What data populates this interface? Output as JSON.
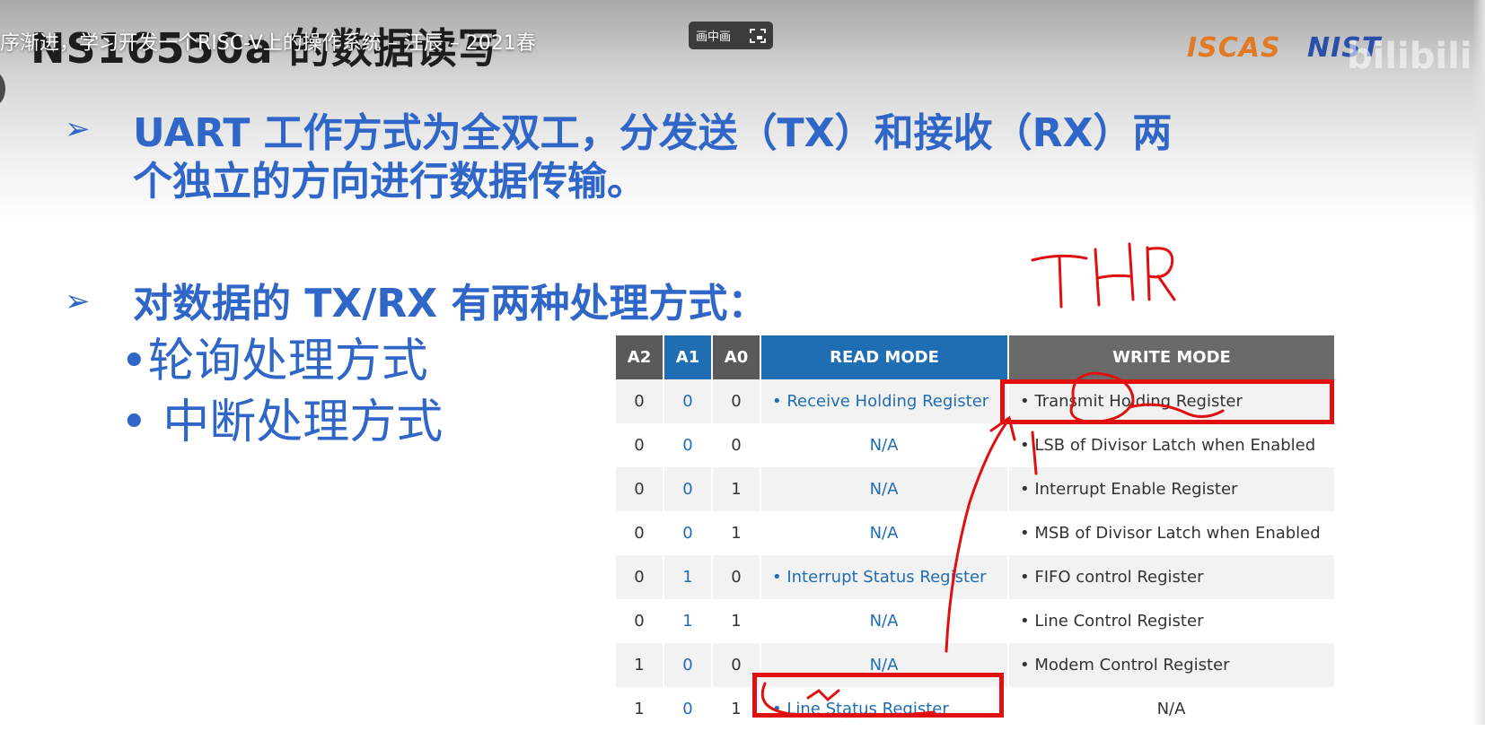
{
  "video": {
    "overlay_title": "序渐进，学习开发一个RISC-V上的操作系统 – 汪辰 – 2021春",
    "pip_label": "画中画"
  },
  "slide": {
    "title_behind": "NS16550a 的数据读写",
    "logos": {
      "iscas": "ISCAS",
      "nist": "NIST",
      "bilibili": "bilibili"
    },
    "bullet1_line1": "UART 工作方式为全双工，分发送（TX）和接收（RX）两",
    "bullet1_line2": "个独立的方向进行数据传输。",
    "bullet2": "对数据的 TX/RX 有两种处理方式：",
    "sub_bullets": [
      "•轮询处理方式",
      "• 中断处理方式"
    ],
    "handwritten_note": "THR"
  },
  "table": {
    "headers": [
      "A2",
      "A1",
      "A0",
      "READ MODE",
      "WRITE MODE"
    ],
    "rows": [
      {
        "a2": "0",
        "a1": "0",
        "a0": "0",
        "read": "• Receive Holding Register",
        "write": "• Transmit Holding Register"
      },
      {
        "a2": "0",
        "a1": "0",
        "a0": "0",
        "read": "N/A",
        "write": "• LSB of Divisor Latch when Enabled"
      },
      {
        "a2": "0",
        "a1": "0",
        "a0": "1",
        "read": "N/A",
        "write": "• Interrupt Enable Register"
      },
      {
        "a2": "0",
        "a1": "0",
        "a0": "1",
        "read": "N/A",
        "write": "• MSB of Divisor Latch when Enabled"
      },
      {
        "a2": "0",
        "a1": "1",
        "a0": "0",
        "read": "• Interrupt Status Register",
        "write": "• FIFO control Register"
      },
      {
        "a2": "0",
        "a1": "1",
        "a0": "1",
        "read": "N/A",
        "write": "• Line Control Register"
      },
      {
        "a2": "1",
        "a1": "0",
        "a0": "0",
        "read": "N/A",
        "write": "• Modem Control Register"
      },
      {
        "a2": "1",
        "a1": "0",
        "a0": "1",
        "read": "• Line Status Register",
        "write": "N/A"
      }
    ]
  },
  "colors": {
    "slide_blue": "#2f66c8",
    "table_blue": "#1f6db3",
    "annotation_red": "#e01010"
  }
}
